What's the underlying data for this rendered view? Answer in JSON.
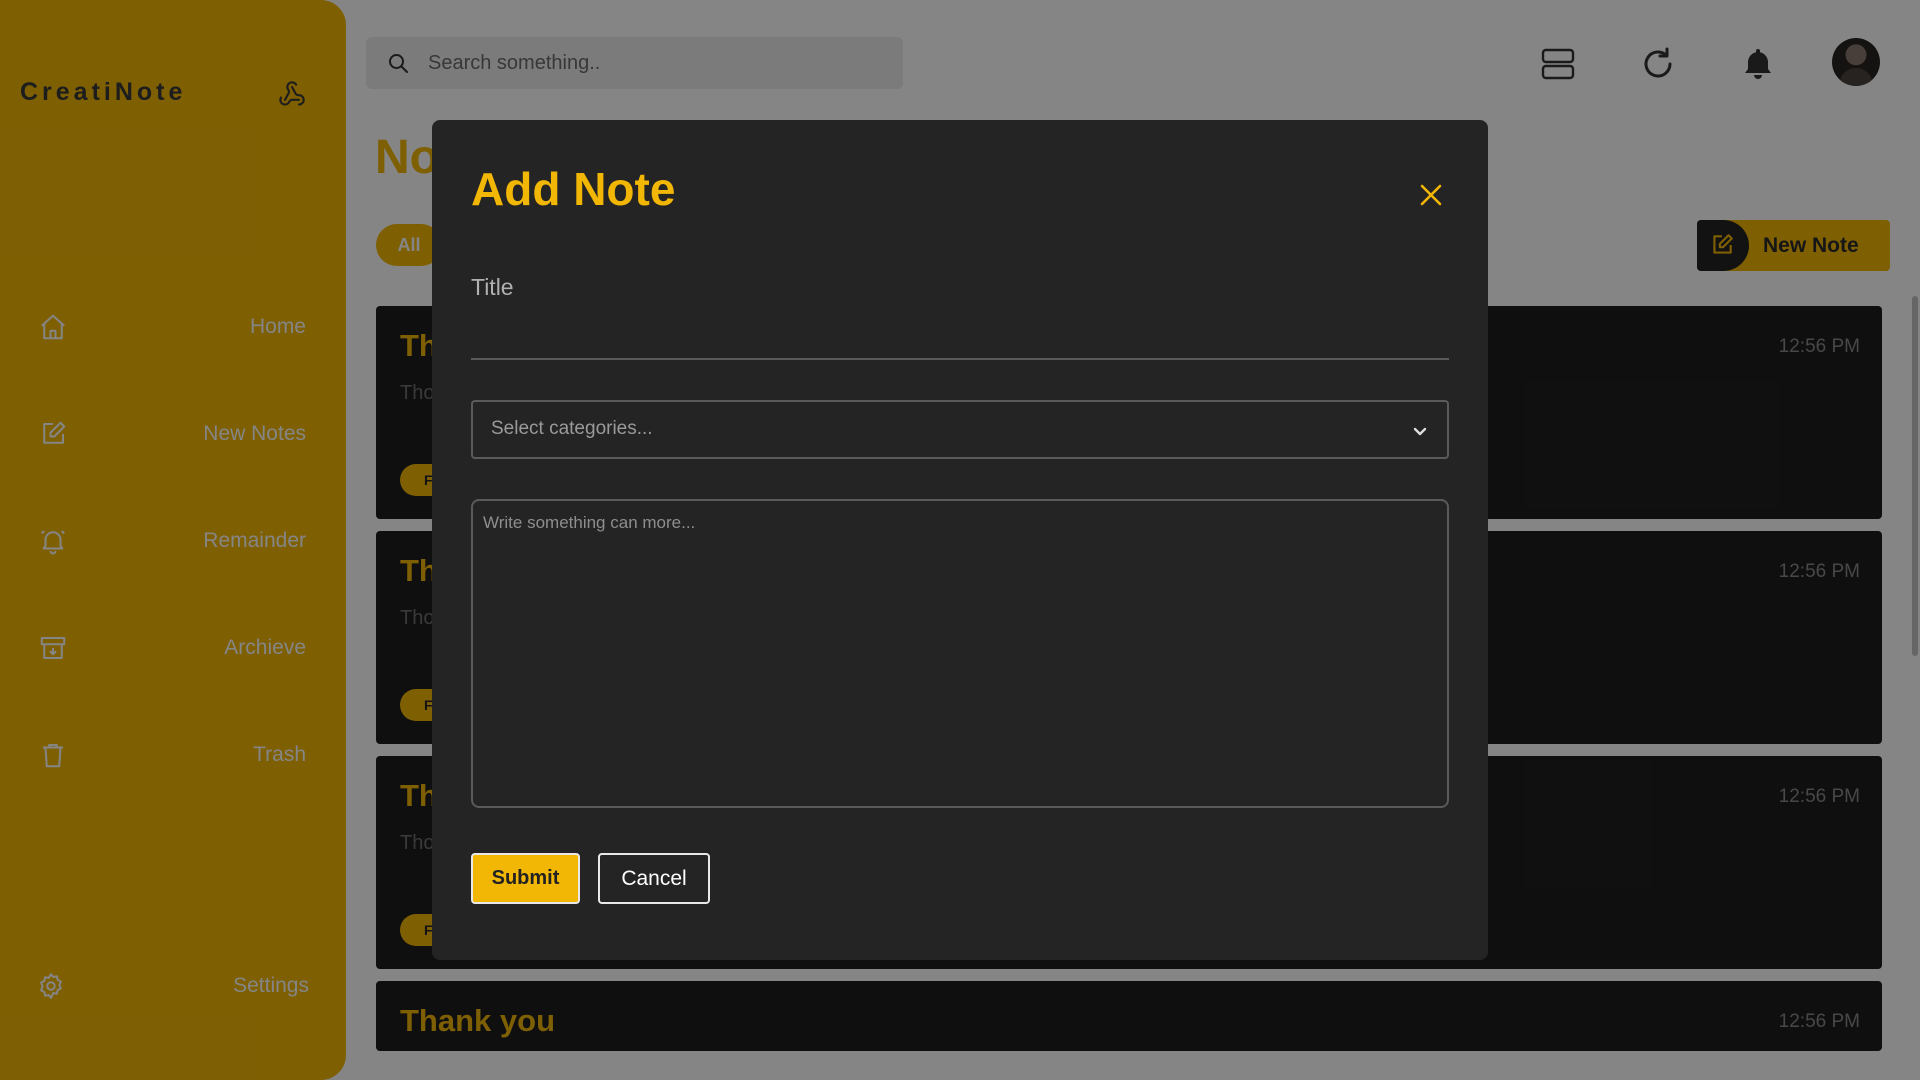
{
  "app": {
    "brand": "CreatiNote"
  },
  "sidebar": {
    "items": [
      {
        "label": "Home",
        "icon": "home-icon"
      },
      {
        "label": "New Notes",
        "icon": "edit-icon"
      },
      {
        "label": "Remainder",
        "icon": "bell-icon"
      },
      {
        "label": "Archieve",
        "icon": "archive-icon"
      },
      {
        "label": "Trash",
        "icon": "trash-icon"
      }
    ],
    "settings": {
      "label": "Settings",
      "icon": "gear-icon"
    }
  },
  "topbar": {
    "search_placeholder": "Search something..",
    "icons": [
      "layout-icon",
      "refresh-icon",
      "bell-icon",
      "avatar"
    ]
  },
  "main": {
    "title": "No",
    "filter_active": "All",
    "new_note_label": "New Note",
    "notes": [
      {
        "title": "Th",
        "body": "Tho",
        "time": "12:56 PM",
        "tag": "F"
      },
      {
        "title": "Th",
        "body": "Tho",
        "time": "12:56 PM",
        "tag": "F"
      },
      {
        "title": "Th",
        "body": "Tho",
        "time": "12:56 PM",
        "tag": "F"
      },
      {
        "title": "Thank you",
        "body": "",
        "time": "12:56 PM",
        "tag": ""
      }
    ]
  },
  "modal": {
    "title": "Add Note",
    "title_field_label": "Title",
    "title_value": "",
    "category_placeholder": "Select categories...",
    "content_placeholder": "Write something can more...",
    "submit_label": "Submit",
    "cancel_label": "Cancel"
  },
  "colors": {
    "accent": "#F2B705",
    "card": "#1e1e1e",
    "modal": "#242424"
  }
}
